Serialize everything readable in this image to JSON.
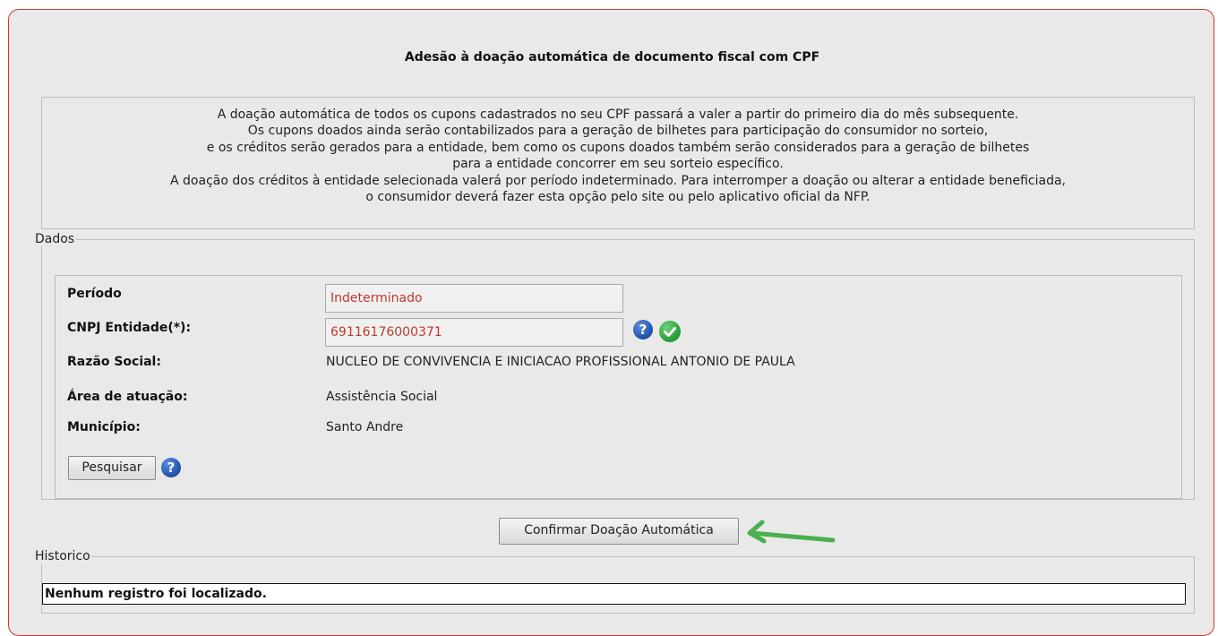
{
  "page": {
    "title": "Adesão à doação automática de documento fiscal com CPF"
  },
  "info": {
    "lines": [
      "A doação automática de todos os cupons cadastrados no seu CPF passará a valer a partir do primeiro dia do mês subsequente.",
      "Os cupons doados ainda serão contabilizados para a geração de bilhetes para participação do consumidor no sorteio,",
      "e os créditos serão gerados para a entidade, bem como os cupons doados também serão considerados para a geração de bilhetes",
      "para a entidade concorrer em seu sorteio específico.",
      "A doação dos créditos à entidade selecionada valerá por período indeterminado. Para interromper a doação ou alterar a entidade beneficiada,",
      "o consumidor deverá fazer esta opção pelo site ou pelo aplicativo oficial da NFP."
    ]
  },
  "dados": {
    "legend": "Dados",
    "periodo_label": "Período",
    "periodo_value": "Indeterminado",
    "cnpj_label": "CNPJ Entidade(*):",
    "cnpj_value": "69116176000371",
    "razao_label": "Razão Social:",
    "razao_value": "NUCLEO DE CONVIVENCIA E INICIACAO PROFISSIONAL ANTONIO DE PAULA",
    "area_label": "Área de atuação:",
    "area_value": "Assistência Social",
    "municipio_label": "Município:",
    "municipio_value": "Santo Andre",
    "pesquisar_label": "Pesquisar"
  },
  "confirm": {
    "label": "Confirmar Doação Automática"
  },
  "historico": {
    "legend": "Historico",
    "empty_message": "Nenhum registro foi localizado."
  },
  "icons": {
    "help": "question-circle-icon",
    "valid": "check-circle-icon",
    "annotation": "arrow-left-icon"
  },
  "colors": {
    "panel_border": "#d9342b",
    "field_text": "#c0392b",
    "arrow": "#4caf50"
  }
}
